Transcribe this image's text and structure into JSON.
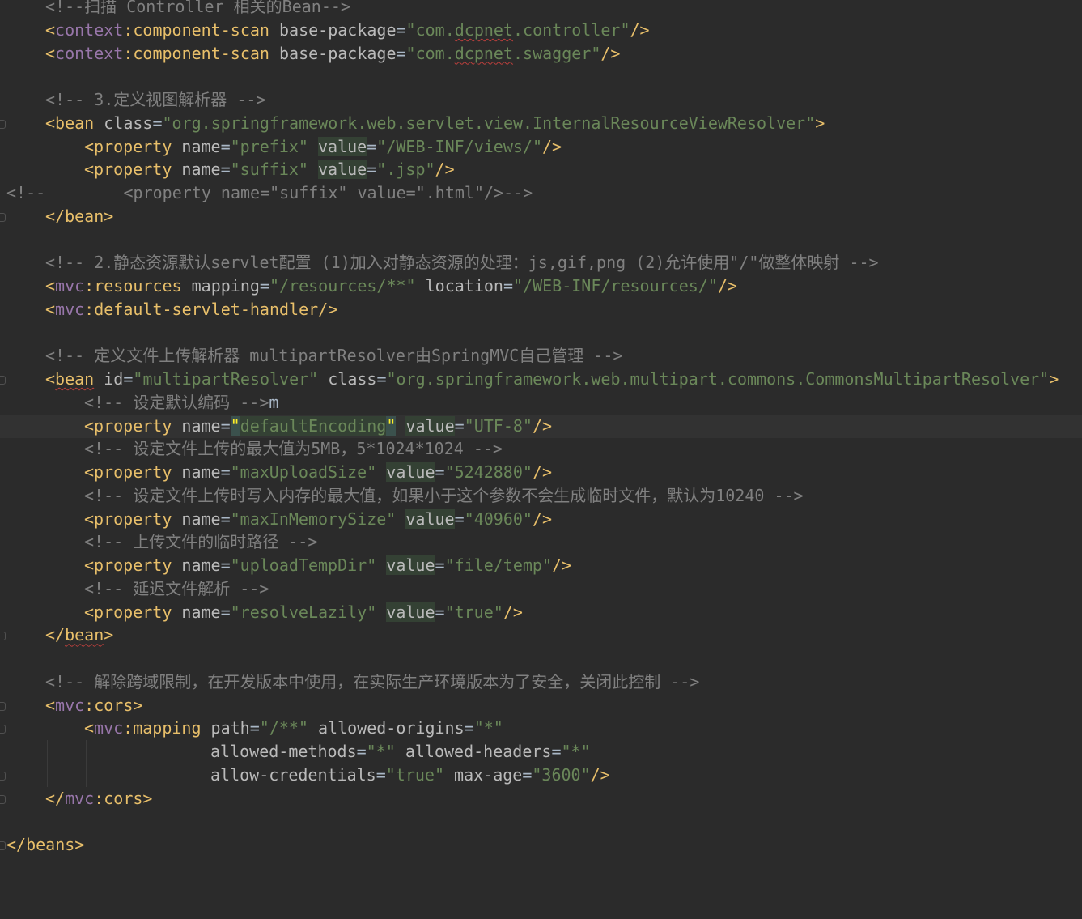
{
  "theme": {
    "background": "#2b2b2b",
    "current_line": "#323232",
    "tag_color": "#e8bf6a",
    "namespace_color": "#9876aa",
    "attribute_color": "#bababa",
    "string_color": "#6a8759",
    "comment_color": "#808080",
    "text_color": "#a9b7c6"
  },
  "lines": [
    {
      "indent": 4,
      "fold": false,
      "tokens": [
        {
          "t": "<!--扫描 Controller 相关的Bean-->",
          "c": "cm"
        }
      ]
    },
    {
      "indent": 4,
      "fold": false,
      "tokens": [
        {
          "t": "<",
          "c": "tag"
        },
        {
          "t": "context",
          "c": "ns"
        },
        {
          "t": ":component-scan ",
          "c": "tag"
        },
        {
          "t": "base-package",
          "c": "attr"
        },
        {
          "t": "=",
          "c": "eq"
        },
        {
          "t": "\"com.",
          "c": "val"
        },
        {
          "t": "dcpnet",
          "c": "val sq"
        },
        {
          "t": ".controller\"",
          "c": "val"
        },
        {
          "t": "/>",
          "c": "tag"
        }
      ]
    },
    {
      "indent": 4,
      "fold": false,
      "tokens": [
        {
          "t": "<",
          "c": "tag"
        },
        {
          "t": "context",
          "c": "ns"
        },
        {
          "t": ":component-scan ",
          "c": "tag"
        },
        {
          "t": "base-package",
          "c": "attr"
        },
        {
          "t": "=",
          "c": "eq"
        },
        {
          "t": "\"com.",
          "c": "val"
        },
        {
          "t": "dcpnet",
          "c": "val sq"
        },
        {
          "t": ".swagger\"",
          "c": "val"
        },
        {
          "t": "/>",
          "c": "tag"
        }
      ]
    },
    {
      "indent": 0,
      "fold": false,
      "tokens": []
    },
    {
      "indent": 4,
      "fold": false,
      "tokens": [
        {
          "t": "<!-- 3.定义视图解析器 -->",
          "c": "cm"
        }
      ]
    },
    {
      "indent": 4,
      "fold": true,
      "tokens": [
        {
          "t": "<bean ",
          "c": "tag"
        },
        {
          "t": "class",
          "c": "attr"
        },
        {
          "t": "=",
          "c": "eq"
        },
        {
          "t": "\"org.springframework.web.servlet.view.InternalResourceViewResolver\"",
          "c": "val"
        },
        {
          "t": ">",
          "c": "tag"
        }
      ]
    },
    {
      "indent": 8,
      "fold": false,
      "tokens": [
        {
          "t": "<property ",
          "c": "tag"
        },
        {
          "t": "name",
          "c": "attr"
        },
        {
          "t": "=",
          "c": "eq"
        },
        {
          "t": "\"prefix\" ",
          "c": "val"
        },
        {
          "t": "value",
          "c": "attr hl"
        },
        {
          "t": "=",
          "c": "eq"
        },
        {
          "t": "\"/WEB-INF/views/\"",
          "c": "val"
        },
        {
          "t": "/>",
          "c": "tag"
        }
      ]
    },
    {
      "indent": 8,
      "fold": false,
      "tokens": [
        {
          "t": "<property ",
          "c": "tag"
        },
        {
          "t": "name",
          "c": "attr"
        },
        {
          "t": "=",
          "c": "eq"
        },
        {
          "t": "\"suffix\" ",
          "c": "val"
        },
        {
          "t": "value",
          "c": "attr hl"
        },
        {
          "t": "=",
          "c": "eq"
        },
        {
          "t": "\".jsp\"",
          "c": "val"
        },
        {
          "t": "/>",
          "c": "tag"
        }
      ]
    },
    {
      "indent": 0,
      "fold": false,
      "tokens": [
        {
          "t": "<!--        <property name=\"suffix\" value=\".html\"/>-->",
          "c": "cm"
        }
      ]
    },
    {
      "indent": 4,
      "fold": true,
      "tokens": [
        {
          "t": "</bean>",
          "c": "tag"
        }
      ]
    },
    {
      "indent": 0,
      "fold": false,
      "tokens": []
    },
    {
      "indent": 4,
      "fold": false,
      "tokens": [
        {
          "t": "<!-- 2.静态资源默认servlet配置 (1)加入对静态资源的处理：js,gif,png (2)允许使用\"/\"做整体映射 -->",
          "c": "cm"
        }
      ]
    },
    {
      "indent": 4,
      "fold": false,
      "tokens": [
        {
          "t": "<",
          "c": "tag"
        },
        {
          "t": "mvc",
          "c": "ns"
        },
        {
          "t": ":resources ",
          "c": "tag"
        },
        {
          "t": "mapping",
          "c": "attr"
        },
        {
          "t": "=",
          "c": "eq"
        },
        {
          "t": "\"/resources/**\" ",
          "c": "val"
        },
        {
          "t": "location",
          "c": "attr"
        },
        {
          "t": "=",
          "c": "eq"
        },
        {
          "t": "\"/WEB-INF/resources/\"",
          "c": "val"
        },
        {
          "t": "/>",
          "c": "tag"
        }
      ]
    },
    {
      "indent": 4,
      "fold": false,
      "tokens": [
        {
          "t": "<",
          "c": "tag"
        },
        {
          "t": "mvc",
          "c": "ns"
        },
        {
          "t": ":default-servlet-handler/>",
          "c": "tag"
        }
      ]
    },
    {
      "indent": 0,
      "fold": false,
      "tokens": []
    },
    {
      "indent": 4,
      "fold": false,
      "tokens": [
        {
          "t": "<!-- 定义文件上传解析器 multipartResolver由SpringMVC自己管理 -->",
          "c": "cm"
        }
      ]
    },
    {
      "indent": 4,
      "fold": true,
      "tokens": [
        {
          "t": "<",
          "c": "tag"
        },
        {
          "t": "bean",
          "c": "tag sq"
        },
        {
          "t": " ",
          "c": "tag"
        },
        {
          "t": "id",
          "c": "attr"
        },
        {
          "t": "=",
          "c": "eq"
        },
        {
          "t": "\"multipartResolver\" ",
          "c": "val"
        },
        {
          "t": "class",
          "c": "attr"
        },
        {
          "t": "=",
          "c": "eq"
        },
        {
          "t": "\"org.springframework.web.multipart.commons.CommonsMultipartResolver\"",
          "c": "val"
        },
        {
          "t": ">",
          "c": "tag"
        }
      ]
    },
    {
      "indent": 8,
      "fold": false,
      "tokens": [
        {
          "t": "<!-- 设定默认编码 -->",
          "c": "cm"
        },
        {
          "t": "m",
          "c": "text"
        }
      ]
    },
    {
      "indent": 8,
      "fold": false,
      "current": true,
      "tokens": [
        {
          "t": "<property ",
          "c": "tag"
        },
        {
          "t": "name",
          "c": "attr"
        },
        {
          "t": "=",
          "c": "eq"
        },
        {
          "t": "\"",
          "c": "brace"
        },
        {
          "t": "defaultEncoding",
          "c": "val hl"
        },
        {
          "t": "\"",
          "c": "brace"
        },
        {
          "t": " ",
          "c": "text"
        },
        {
          "t": "",
          "c": "caret"
        },
        {
          "t": "value",
          "c": "attr hl"
        },
        {
          "t": "=",
          "c": "eq"
        },
        {
          "t": "\"UTF-8\"",
          "c": "val"
        },
        {
          "t": "/>",
          "c": "tag"
        }
      ]
    },
    {
      "indent": 8,
      "fold": false,
      "tokens": [
        {
          "t": "<!-- 设定文件上传的最大值为5MB，5*1024*1024 -->",
          "c": "cm"
        }
      ]
    },
    {
      "indent": 8,
      "fold": false,
      "tokens": [
        {
          "t": "<property ",
          "c": "tag"
        },
        {
          "t": "name",
          "c": "attr"
        },
        {
          "t": "=",
          "c": "eq"
        },
        {
          "t": "\"maxUploadSize\" ",
          "c": "val"
        },
        {
          "t": "value",
          "c": "attr hl"
        },
        {
          "t": "=",
          "c": "eq"
        },
        {
          "t": "\"5242880\"",
          "c": "val"
        },
        {
          "t": "/>",
          "c": "tag"
        }
      ]
    },
    {
      "indent": 8,
      "fold": false,
      "tokens": [
        {
          "t": "<!-- 设定文件上传时写入内存的最大值，如果小于这个参数不会生成临时文件，默认为10240 -->",
          "c": "cm"
        }
      ]
    },
    {
      "indent": 8,
      "fold": false,
      "tokens": [
        {
          "t": "<property ",
          "c": "tag"
        },
        {
          "t": "name",
          "c": "attr"
        },
        {
          "t": "=",
          "c": "eq"
        },
        {
          "t": "\"maxInMemorySize\" ",
          "c": "val"
        },
        {
          "t": "value",
          "c": "attr hl"
        },
        {
          "t": "=",
          "c": "eq"
        },
        {
          "t": "\"40960\"",
          "c": "val"
        },
        {
          "t": "/>",
          "c": "tag"
        }
      ]
    },
    {
      "indent": 8,
      "fold": false,
      "tokens": [
        {
          "t": "<!-- 上传文件的临时路径 -->",
          "c": "cm"
        }
      ]
    },
    {
      "indent": 8,
      "fold": false,
      "tokens": [
        {
          "t": "<property ",
          "c": "tag"
        },
        {
          "t": "name",
          "c": "attr"
        },
        {
          "t": "=",
          "c": "eq"
        },
        {
          "t": "\"uploadTempDir\" ",
          "c": "val"
        },
        {
          "t": "value",
          "c": "attr hl"
        },
        {
          "t": "=",
          "c": "eq"
        },
        {
          "t": "\"file/temp\"",
          "c": "val"
        },
        {
          "t": "/>",
          "c": "tag"
        }
      ]
    },
    {
      "indent": 8,
      "fold": false,
      "tokens": [
        {
          "t": "<!-- 延迟文件解析 -->",
          "c": "cm"
        }
      ]
    },
    {
      "indent": 8,
      "fold": false,
      "tokens": [
        {
          "t": "<property ",
          "c": "tag"
        },
        {
          "t": "name",
          "c": "attr"
        },
        {
          "t": "=",
          "c": "eq"
        },
        {
          "t": "\"resolveLazily\" ",
          "c": "val"
        },
        {
          "t": "value",
          "c": "attr hl"
        },
        {
          "t": "=",
          "c": "eq"
        },
        {
          "t": "\"true\"",
          "c": "val"
        },
        {
          "t": "/>",
          "c": "tag"
        }
      ]
    },
    {
      "indent": 4,
      "fold": true,
      "tokens": [
        {
          "t": "</",
          "c": "tag"
        },
        {
          "t": "bean",
          "c": "tag sq"
        },
        {
          "t": ">",
          "c": "tag"
        }
      ]
    },
    {
      "indent": 0,
      "fold": false,
      "tokens": []
    },
    {
      "indent": 4,
      "fold": false,
      "tokens": [
        {
          "t": "<!-- 解除跨域限制，在开发版本中使用，在实际生产环境版本为了安全，关闭此控制 -->",
          "c": "cm"
        }
      ]
    },
    {
      "indent": 4,
      "fold": true,
      "tokens": [
        {
          "t": "<",
          "c": "tag"
        },
        {
          "t": "mvc",
          "c": "ns"
        },
        {
          "t": ":cors>",
          "c": "tag"
        }
      ]
    },
    {
      "indent": 8,
      "fold": true,
      "tokens": [
        {
          "t": "<",
          "c": "tag"
        },
        {
          "t": "mvc",
          "c": "ns"
        },
        {
          "t": ":mapping ",
          "c": "tag"
        },
        {
          "t": "path",
          "c": "attr"
        },
        {
          "t": "=",
          "c": "eq"
        },
        {
          "t": "\"/**\" ",
          "c": "val"
        },
        {
          "t": "allowed-origins",
          "c": "attr"
        },
        {
          "t": "=",
          "c": "eq"
        },
        {
          "t": "\"*\"",
          "c": "val"
        }
      ]
    },
    {
      "indent": 21,
      "fold": false,
      "guides": [
        4,
        8
      ],
      "tokens": [
        {
          "t": "allowed-methods",
          "c": "attr"
        },
        {
          "t": "=",
          "c": "eq"
        },
        {
          "t": "\"*\" ",
          "c": "val"
        },
        {
          "t": "allowed-headers",
          "c": "attr"
        },
        {
          "t": "=",
          "c": "eq"
        },
        {
          "t": "\"*\"",
          "c": "val"
        }
      ]
    },
    {
      "indent": 21,
      "fold": true,
      "guides": [
        4,
        8
      ],
      "tokens": [
        {
          "t": "allow-credentials",
          "c": "attr"
        },
        {
          "t": "=",
          "c": "eq"
        },
        {
          "t": "\"true\" ",
          "c": "val"
        },
        {
          "t": "max-age",
          "c": "attr"
        },
        {
          "t": "=",
          "c": "eq"
        },
        {
          "t": "\"3600\"",
          "c": "val"
        },
        {
          "t": "/>",
          "c": "tag"
        }
      ]
    },
    {
      "indent": 4,
      "fold": true,
      "tokens": [
        {
          "t": "</",
          "c": "tag"
        },
        {
          "t": "mvc",
          "c": "ns"
        },
        {
          "t": ":cors>",
          "c": "tag"
        }
      ]
    },
    {
      "indent": 0,
      "fold": false,
      "tokens": []
    },
    {
      "indent": 0,
      "fold": true,
      "tokens": [
        {
          "t": "</beans>",
          "c": "tag"
        }
      ]
    }
  ]
}
